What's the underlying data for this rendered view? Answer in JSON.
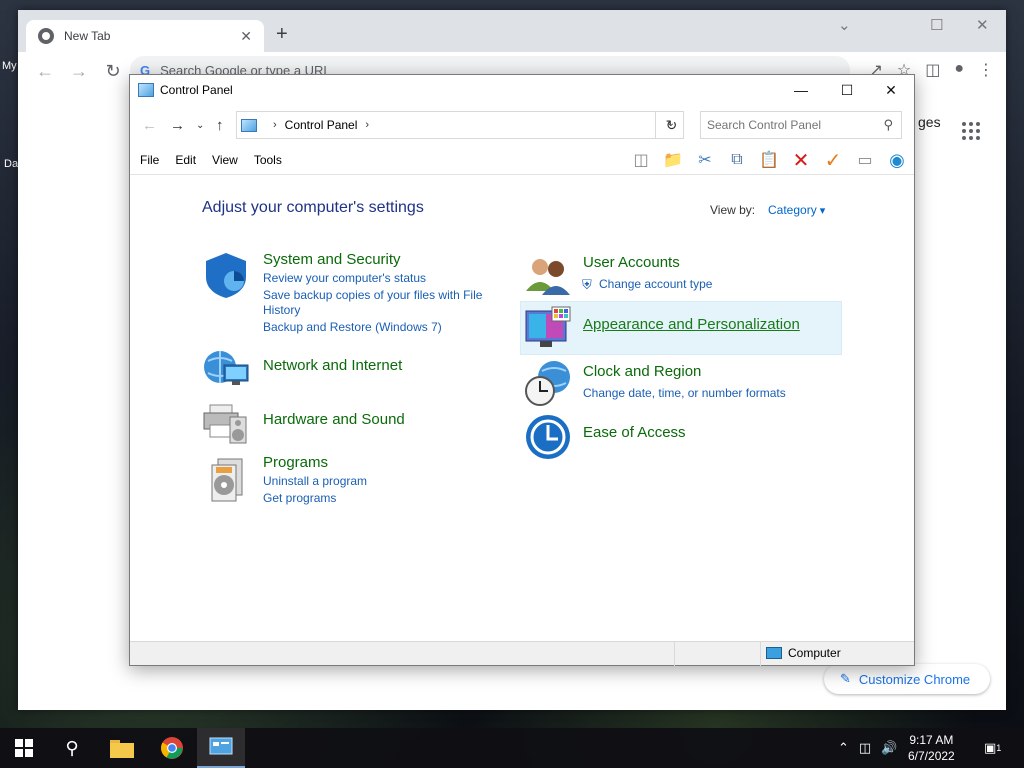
{
  "desktop": {
    "label_1": "My",
    "label_2": "Da"
  },
  "chrome": {
    "tab_title": "New Tab",
    "tab_close": "✕",
    "newtab": "+",
    "omnibox_placeholder": "Search Google or type a URL",
    "omnibox_g": "G",
    "ntp_right_text": "ges",
    "customize_label": "Customize Chrome",
    "caption_min": "⌄",
    "caption_max": "☐",
    "caption_close": "✕"
  },
  "control_panel": {
    "title": "Control Panel",
    "breadcrumb": "Control Panel",
    "search_placeholder": "Search Control Panel",
    "menu": [
      "File",
      "Edit",
      "View",
      "Tools"
    ],
    "heading": "Adjust your computer's settings",
    "view_by_label": "View by:",
    "view_by_value": "Category",
    "status_computer": "Computer",
    "left_categories": [
      {
        "title": "System and Security",
        "links": [
          "Review your computer's status",
          "Save backup copies of your files with File",
          "History",
          "Backup and Restore (Windows 7)"
        ]
      },
      {
        "title": "Network and Internet",
        "links": []
      },
      {
        "title": "Hardware and Sound",
        "links": []
      },
      {
        "title": "Programs",
        "links": [
          "Uninstall a program",
          "Get programs"
        ]
      }
    ],
    "right_categories": [
      {
        "title": "User Accounts",
        "links": [
          "Change account type"
        ]
      },
      {
        "title": "Appearance and Personalization",
        "links": []
      },
      {
        "title": "Clock and Region",
        "links": [
          "Change date, time, or number formats"
        ]
      },
      {
        "title": "Ease of Access",
        "links": []
      }
    ]
  },
  "taskbar": {
    "time": "9:17 AM",
    "date": "6/7/2022",
    "notification_count": "1"
  }
}
